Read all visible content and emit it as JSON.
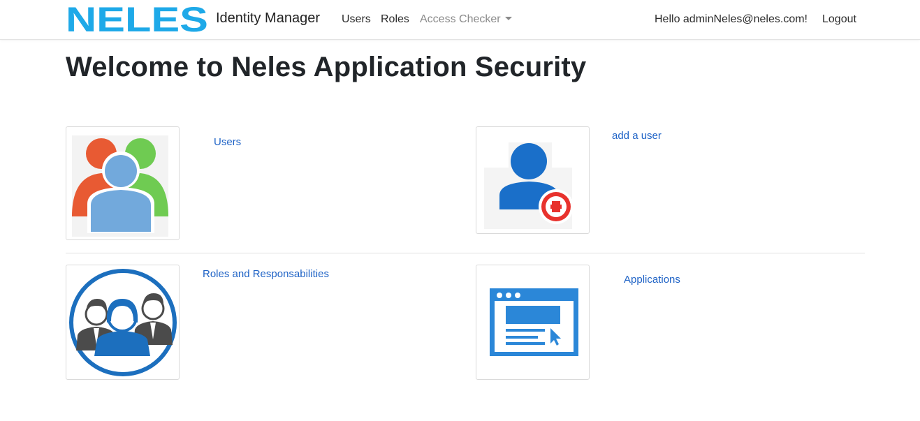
{
  "header": {
    "logo_text": "NELES",
    "brand_title": "Identity Manager",
    "nav": {
      "users": "Users",
      "roles": "Roles",
      "access_checker": "Access Checker"
    },
    "greeting": "Hello adminNeles@neles.com!",
    "logout": "Logout"
  },
  "main": {
    "title": "Welcome to Neles Application Security",
    "cards": {
      "users": "Users",
      "add_user": "add a user",
      "roles": "Roles and Responsabilities",
      "applications": "Applications"
    }
  },
  "colors": {
    "brand_logo": "#1ea9e8",
    "link": "#1f63c6",
    "muted_nav": "#8a8a8a"
  },
  "icons": {
    "users": "users-group-icon",
    "add_user": "add-user-icon",
    "roles": "roles-people-icon",
    "applications": "application-window-icon"
  }
}
